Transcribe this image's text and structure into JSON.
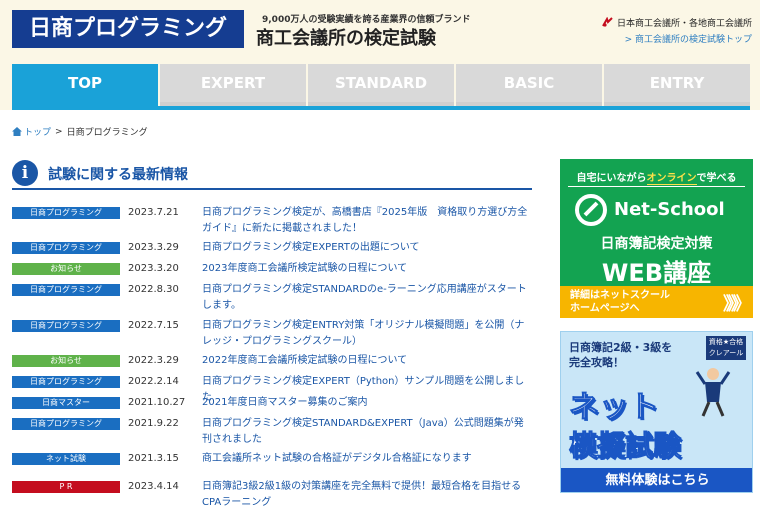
{
  "header": {
    "logo": "日商プログラミング",
    "tagline": "9,000万人の受験実績を誇る産業界の信頼ブランド",
    "title": "商工会議所の検定試験",
    "org": "日本商工会議所・各地商工会議所",
    "org_link": "> 商工会議所の検定試験トップ"
  },
  "nav": {
    "tabs": [
      {
        "label": "TOP",
        "active": true
      },
      {
        "label": "EXPERT",
        "active": false
      },
      {
        "label": "STANDARD",
        "active": false
      },
      {
        "label": "BASIC",
        "active": false
      },
      {
        "label": "ENTRY",
        "active": false
      }
    ]
  },
  "breadcrumb": {
    "home": "トップ",
    "sep": ">",
    "current": "日商プログラミング"
  },
  "section": {
    "icon": "i",
    "title": "試験に関する最新情報"
  },
  "news": [
    {
      "badge": "日商プログラミング",
      "kind": "prog",
      "date": "2023.7.21",
      "title": "日商プログラミング検定が、高橋書店『2025年版　資格取り方選び方全ガイド』に新たに掲載されました！"
    },
    {
      "badge": "日商プログラミング",
      "kind": "prog",
      "date": "2023.3.29",
      "title": "日商プログラミング検定EXPERTの出題について"
    },
    {
      "badge": "お知らせ",
      "kind": "info",
      "date": "2023.3.20",
      "title": "2023年度商工会議所検定試験の日程について"
    },
    {
      "badge": "日商プログラミング",
      "kind": "prog",
      "date": "2022.8.30",
      "title": "日商プログラミング検定STANDARDのe-ラーニング応用講座がスタートします。"
    },
    {
      "badge": "日商プログラミング",
      "kind": "prog",
      "date": "2022.7.15",
      "title": "日商プログラミング検定ENTRY対策「オリジナル模擬問題」を公開（ナレッジ・プログラミングスクール）"
    },
    {
      "badge": "お知らせ",
      "kind": "info",
      "date": "2022.3.29",
      "title": "2022年度商工会議所検定試験の日程について"
    },
    {
      "badge": "日商プログラミング",
      "kind": "prog",
      "date": "2022.2.14",
      "title": "日商プログラミング検定EXPERT（Python）サンプル問題を公開しました"
    },
    {
      "badge": "日商マスター",
      "kind": "master",
      "date": "2021.10.27",
      "title": "2021年度日商マスター募集のご案内"
    },
    {
      "badge": "日商プログラミング",
      "kind": "prog",
      "date": "2021.9.22",
      "title": "日商プログラミング検定STANDARD&EXPERT（Java）公式問題集が発刊されました"
    },
    {
      "badge": "ネット試験",
      "kind": "net",
      "date": "2021.3.15",
      "title": "商工会議所ネット試験の合格証がデジタル合格証になります"
    },
    {
      "badge": "P R",
      "kind": "pr",
      "date": "2023.4.14",
      "title": "日商簿記3級2級1級の対策講座を完全無料で提供！最短合格を目指せるCPAラーニング"
    }
  ],
  "ad1": {
    "top_pre": "自宅にいながら",
    "top_hl": "オンライン",
    "top_post": "で学べる",
    "brand": "Net-School",
    "sub": "日商簿記検定対策",
    "big": "WEB講座",
    "foot_line1": "詳細はネットスクール",
    "foot_line2": "ホームページへ",
    "arrows": "》》》"
  },
  "ad2": {
    "top_line1": "日商簿記2級・3級を",
    "top_line2": "完全攻略！",
    "tag_line1": "資格★合格",
    "tag_line2": "クレアール",
    "big1": "ネット",
    "big2": "模擬試験",
    "foot": "無料体験はこちら"
  },
  "colors": {
    "brand_navy": "#153d91",
    "nav_active": "#1aa2d8",
    "link_blue": "#1a56a6",
    "badge_prog": "#1a6ec1",
    "badge_info": "#5fb24a",
    "badge_pr": "#c40d1e",
    "ad_green": "#13a351",
    "ad_orange": "#f7b500"
  }
}
